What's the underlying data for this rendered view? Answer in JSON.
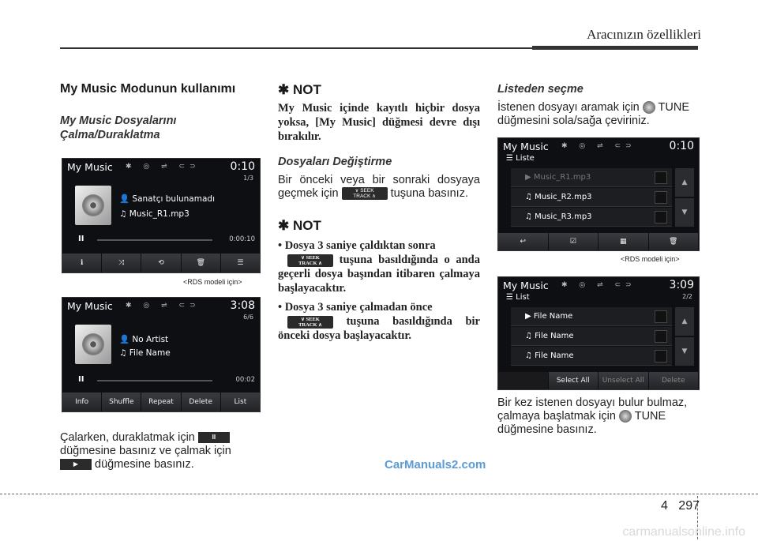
{
  "header": {
    "title": "Aracınızın özellikleri"
  },
  "col1": {
    "heading": "My Music Modunun kullanımı",
    "subheading_line1": "My Music Dosyalarını",
    "subheading_line2": "Çalma/Duraklatma",
    "screen1": {
      "title": "My Music",
      "time": "0:10",
      "counter": "1/3",
      "artist": "Sanatçı bulunamadı",
      "song": "Music_R1.mp3",
      "elapsed": "0:00:10",
      "pause": "II"
    },
    "caption1": "<RDS modeli için>",
    "screen2": {
      "title": "My Music",
      "time": "3:08",
      "counter": "6/6",
      "artist": "No Artist",
      "song": "File Name",
      "elapsed": "00:02",
      "pause": "II",
      "buttons": [
        "Info",
        "Shuffle",
        "Repeat",
        "Delete",
        "List"
      ]
    },
    "para_pre": "Çalarken, duraklatmak için",
    "para_mid": "düğmesine basınız ve çalmak için",
    "para_post": "düğmesine basınız.",
    "pause_label": "II",
    "play_label": "▶"
  },
  "col2": {
    "note1_title": "✱ NOT",
    "note1_text": "My Music içinde kayıtlı hiçbir dosya yoksa, [My Music] düğmesi devre dışı bırakılır.",
    "sub2": "Dosyaları Değiştirme",
    "para2_pre": "Bir önceki veya bir sonraki dosyaya geçmek için",
    "para2_post": "tuşuna basınız.",
    "seek_line1": "SEEK",
    "seek_line2": "TRACK",
    "note2_title": "✱ NOT",
    "bullet1_pre": "• Dosya 3 saniye çaldıktan sonra",
    "bullet1_post": "tuşuna basıldığında o anda geçerli dosya başından itibaren çalmaya başlayacaktır.",
    "bullet2_pre": "• Dosya 3 saniye çalmadan önce",
    "bullet2_post": "tuşuna basıldığında bir önceki dosya başlayacaktır."
  },
  "col3": {
    "sub": "Listeden seçme",
    "para1_pre": "İstenen dosyayı aramak için",
    "para1_post": "TUNE düğmesini sola/sağa çeviriniz.",
    "screen3": {
      "title": "My Music",
      "time": "0:10",
      "list_label": "Liste",
      "rows": [
        "Music_R1.mp3",
        "Music_R2.mp3",
        "Music_R3.mp3"
      ]
    },
    "caption3": "<RDS modeli için>",
    "screen4": {
      "title": "My Music",
      "time": "3:09",
      "list_label": "List",
      "counter": "2/2",
      "rows": [
        "File Name",
        "File Name",
        "File Name"
      ],
      "buttons": [
        "Select All",
        "Unselect All",
        "Delete"
      ]
    },
    "para2_pre": "Bir kez istenen dosyayı bulur bulmaz, çalmaya başlatmak için",
    "para2_post": "TUNE düğmesine basınız."
  },
  "watermark": "CarManuals2.com",
  "footer": {
    "chapter": "4",
    "page": "297"
  },
  "watermark2": "carmanualsonline.info"
}
